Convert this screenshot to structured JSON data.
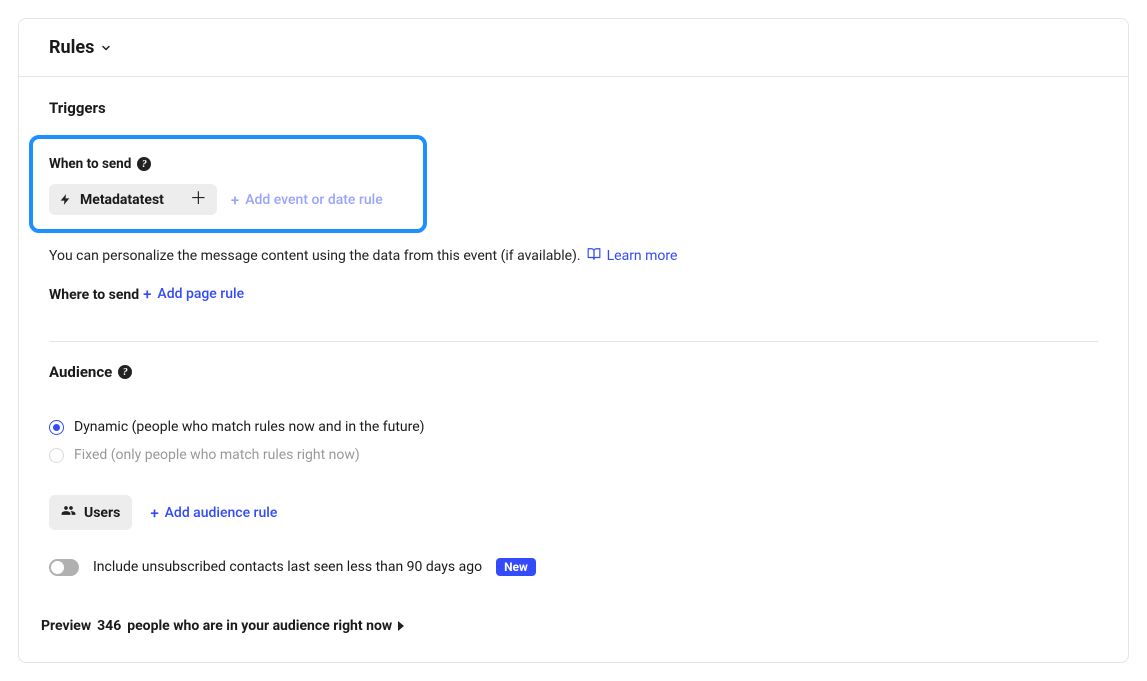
{
  "header": {
    "title": "Rules"
  },
  "triggers": {
    "title": "Triggers",
    "when_label": "When to send",
    "chip_label": "Metadatatest",
    "add_event_label": "Add event or date rule",
    "helper_text": "You can personalize the message content using the data from this event (if available).",
    "learn_more": "Learn more",
    "where_label": "Where to send",
    "add_page_label": "Add page rule"
  },
  "audience": {
    "title": "Audience",
    "dynamic_label": "Dynamic (people who match rules now and in the future)",
    "fixed_label": "Fixed (only people who match rules right now)",
    "users_btn": "Users",
    "add_rule": "Add audience rule",
    "toggle_label": "Include unsubscribed contacts last seen less than 90 days ago",
    "new_badge": "New",
    "preview_prefix": "Preview",
    "preview_count": "346",
    "preview_suffix": "people who are in your audience right now"
  }
}
